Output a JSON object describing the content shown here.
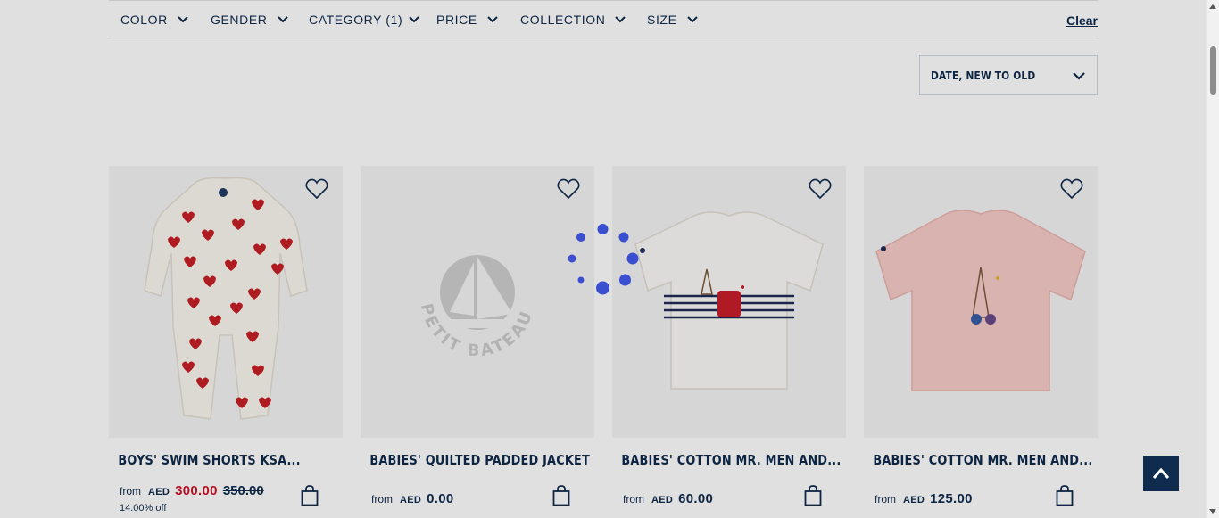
{
  "filters": {
    "color": "COLOR",
    "gender": "GENDER",
    "category": "CATEGORY (1)",
    "price": "PRICE",
    "collection": "COLLECTION",
    "size": "SIZE",
    "clear": "Clear"
  },
  "sort": {
    "label": "DATE, NEW TO OLD"
  },
  "products": [
    {
      "name": "BOYS' SWIM SHORTS KSA...",
      "from": "from",
      "currency": "AED",
      "price": "300.00",
      "old_price": "350.00",
      "discount": "14.00% off"
    },
    {
      "name": "BABIES' QUILTED PADDED JACKET",
      "from": "from",
      "currency": "AED",
      "price": "0.00",
      "placeholder_logo": "PETIT BATEAU"
    },
    {
      "name": "BABIES' COTTON MR. MEN AND...",
      "from": "from",
      "currency": "AED",
      "price": "60.00"
    },
    {
      "name": "BABIES' COTTON MR. MEN AND...",
      "from": "from",
      "currency": "AED",
      "price": "125.00"
    }
  ],
  "icons": {
    "heart": "heart-icon",
    "bag": "shopping-bag-icon",
    "chevron": "chevron-down-icon",
    "back_to_top": "chevron-up-icon"
  },
  "colors": {
    "navy": "#0f2b4d",
    "sale_red": "#d0112b",
    "spinner_blue": "#3a4fd0"
  }
}
